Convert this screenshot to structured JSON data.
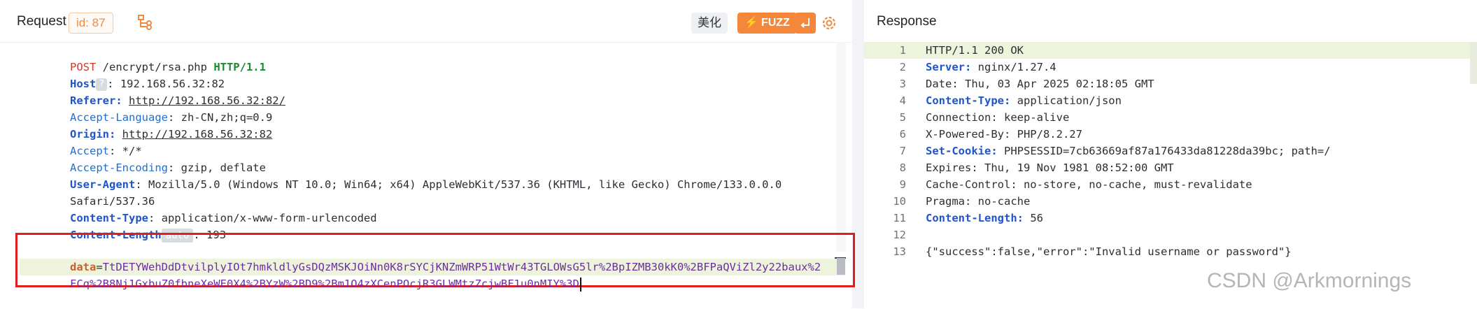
{
  "request": {
    "title": "Request",
    "id_badge": "id: 87",
    "beautify_label": "美化",
    "fuzz_label": "FUZZ",
    "lines": {
      "method": "POST",
      "path": " /encrypt/rsa.php ",
      "protocol": "HTTP/1.1",
      "host_key": "Host",
      "host_badge": "?",
      "host_val": ": 192.168.56.32:82",
      "referer_key": "Referer:",
      "referer_val": "http://192.168.56.32:82/",
      "acclang_key": "Accept-Language",
      "acclang_val": ": zh-CN,zh;q=0.9",
      "origin_key": "Origin:",
      "origin_val": "http://192.168.56.32:82",
      "accept_key": "Accept",
      "accept_val": ": */*",
      "accenc_key": "Accept-Encoding",
      "accenc_val": ": gzip, deflate",
      "ua_key": "User-Agent",
      "ua_val": ": Mozilla/5.0 (Windows NT 10.0; Win64; x64) AppleWebKit/537.36 (KHTML, like Gecko) Chrome/133.0.0.0",
      "ua_cont": "Safari/537.36",
      "ctype_key": "Content-Type",
      "ctype_val": ": application/x-www-form-urlencoded",
      "clen_key": "Content-Length",
      "clen_badge": "auto",
      "clen_val": ": 193",
      "data_key": "data",
      "data_eq": "=",
      "data_val1": "TtDETYWehDdDtvilplyIOt7hmkldlyGsDQzMSKJOiNn0K8rSYCjKNZmWRP51WtWr43TGLOWsG5lr%2BpIZMB30kK0%2BFPaQViZl2y22baux%2",
      "data_val2": "FCq%2B8Nj1GxbuZ0fbneXeWE0X4%2BYzW%2BD9%2Bm1O4zXCenPOcjR3GLWMtzZcjwBF1u0nMIY%3D"
    }
  },
  "response": {
    "title": "Response",
    "line_numbers": [
      "1",
      "2",
      "3",
      "4",
      "5",
      "6",
      "7",
      "8",
      "9",
      "10",
      "11",
      "12",
      "13"
    ],
    "l1": "HTTP/1.1 200 OK",
    "l2_key": "Server:",
    "l2_val": " nginx/1.27.4",
    "l3": "Date: Thu, 03 Apr 2025 02:18:05 GMT",
    "l4_key": "Content-Type:",
    "l4_val": " application/json",
    "l5": "Connection: keep-alive",
    "l6": "X-Powered-By: PHP/8.2.27",
    "l7_key": "Set-Cookie:",
    "l7_val": " PHPSESSID=7cb63669af87a176433da81228da39bc; path=/",
    "l8": "Expires: Thu, 19 Nov 1981 08:52:00 GMT",
    "l9": "Cache-Control: no-store, no-cache, must-revalidate",
    "l10": "Pragma: no-cache",
    "l11_key": "Content-Length:",
    "l11_val": " 56",
    "l13": "{\"success\":false,\"error\":\"Invalid username or password\"}"
  },
  "watermark": "CSDN @Arkmornings",
  "colors": {
    "accent": "#f5873a",
    "highlight_box": "#e01e1e",
    "key_blue": "#1f6fd1"
  }
}
